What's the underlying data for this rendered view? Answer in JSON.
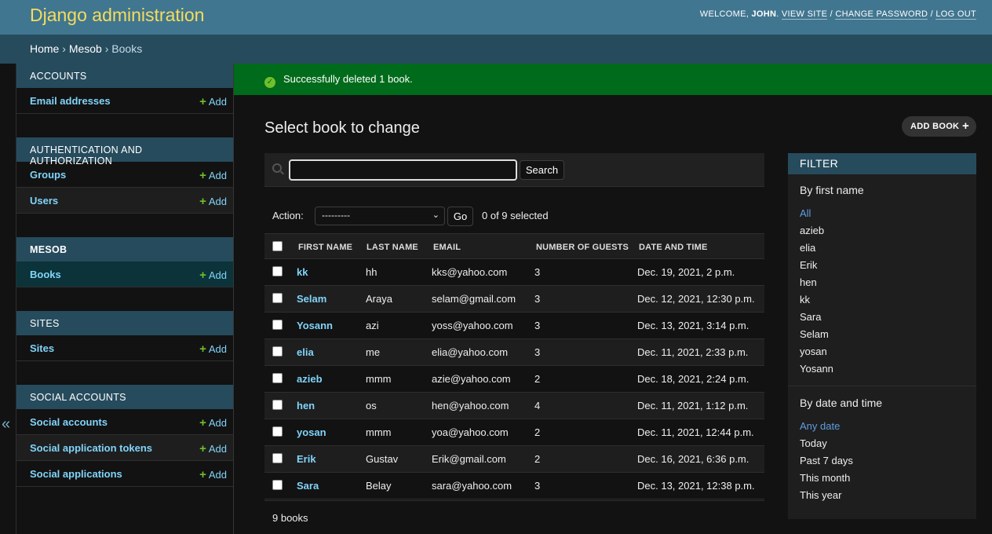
{
  "header": {
    "branding": "Django administration",
    "welcome": "WELCOME, ",
    "user": "JOHN",
    "view_site": "VIEW SITE",
    "change_password": "CHANGE PASSWORD",
    "log_out": "LOG OUT"
  },
  "breadcrumbs": {
    "home": "Home",
    "app": "Mesob",
    "model": "Books"
  },
  "nav_toggle": "«",
  "sidebar": {
    "add_label": "Add",
    "modules": [
      {
        "caption": "ACCOUNTS",
        "items": [
          {
            "label": "Email addresses"
          }
        ]
      },
      {
        "caption": "AUTHENTICATION AND AUTHORIZATION",
        "items": [
          {
            "label": "Groups"
          },
          {
            "label": "Users"
          }
        ]
      },
      {
        "caption": "MESOB",
        "items": [
          {
            "label": "Books"
          }
        ]
      },
      {
        "caption": "SITES",
        "items": [
          {
            "label": "Sites"
          }
        ]
      },
      {
        "caption": "SOCIAL ACCOUNTS",
        "items": [
          {
            "label": "Social accounts"
          },
          {
            "label": "Social application tokens"
          },
          {
            "label": "Social applications"
          }
        ]
      }
    ]
  },
  "message": "Successfully deleted 1 book.",
  "content": {
    "title": "Select book to change",
    "add_button": "ADD BOOK"
  },
  "search": {
    "value": "",
    "button": "Search"
  },
  "actions": {
    "label": "Action:",
    "selected": "---------",
    "go": "Go",
    "count": "0 of 9 selected"
  },
  "table": {
    "headers": [
      "FIRST NAME",
      "LAST NAME",
      "EMAIL",
      "NUMBER OF GUESTS",
      "DATE AND TIME"
    ],
    "rows": [
      [
        "kk",
        "hh",
        "kks@yahoo.com",
        "3",
        "Dec. 19, 2021, 2 p.m."
      ],
      [
        "Selam",
        "Araya",
        "selam@gmail.com",
        "3",
        "Dec. 12, 2021, 12:30 p.m."
      ],
      [
        "Yosann",
        "azi",
        "yoss@yahoo.com",
        "3",
        "Dec. 13, 2021, 3:14 p.m."
      ],
      [
        "elia",
        "me",
        "elia@yahoo.com",
        "3",
        "Dec. 11, 2021, 2:33 p.m."
      ],
      [
        "azieb",
        "mmm",
        "azie@yahoo.com",
        "2",
        "Dec. 18, 2021, 2:24 p.m."
      ],
      [
        "hen",
        "os",
        "hen@yahoo.com",
        "4",
        "Dec. 11, 2021, 1:12 p.m."
      ],
      [
        "yosan",
        "mmm",
        "yoa@yahoo.com",
        "2",
        "Dec. 11, 2021, 12:44 p.m."
      ],
      [
        "Erik",
        "Gustav",
        "Erik@gmail.com",
        "2",
        "Dec. 16, 2021, 6:36 p.m."
      ],
      [
        "Sara",
        "Belay",
        "sara@yahoo.com",
        "3",
        "Dec. 13, 2021, 12:38 p.m."
      ]
    ]
  },
  "paginator": "9 books",
  "filter": {
    "title": "FILTER",
    "sections": [
      {
        "title": "By first name",
        "items": [
          "All",
          "azieb",
          "elia",
          "Erik",
          "hen",
          "kk",
          "Sara",
          "Selam",
          "yosan",
          "Yosann"
        ]
      },
      {
        "title": "By date and time",
        "items": [
          "Any date",
          "Today",
          "Past 7 days",
          "This month",
          "This year"
        ]
      }
    ]
  },
  "colors": {
    "header_bg": "#417690",
    "branding": "#f5dd5d",
    "breadcrumb_bg": "#264b5d",
    "success_bg": "#006b1b",
    "link": "#81d4fa",
    "add_plus": "#70bf2b",
    "filter_selected": "#5f9de0"
  }
}
